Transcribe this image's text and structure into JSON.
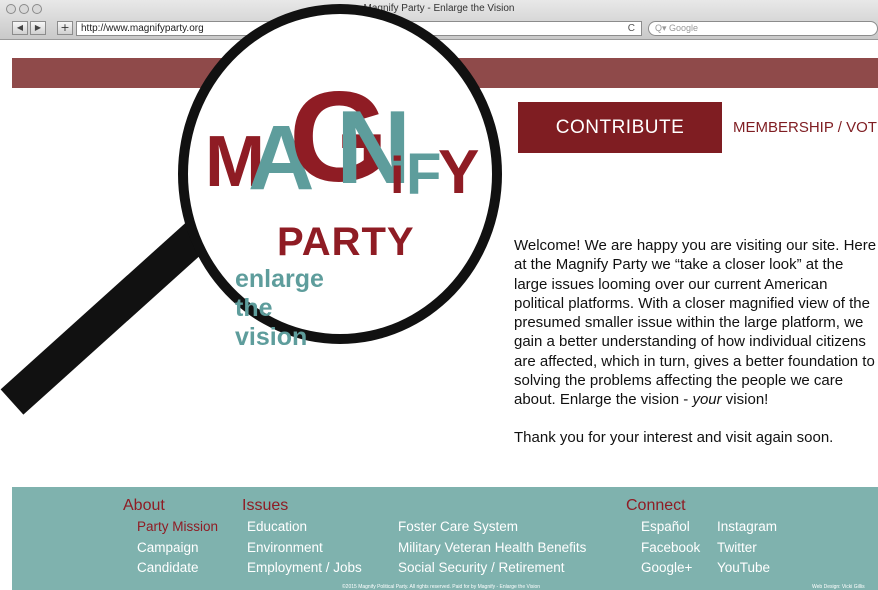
{
  "browser": {
    "window_title": "Magnify Party - Enlarge the Vision",
    "url": "http://www.magnifyparty.org",
    "search_placeholder": "Google",
    "back_glyph": "◀",
    "forward_glyph": "▶",
    "add_glyph": "+",
    "reload_glyph": "C"
  },
  "logo": {
    "letters": [
      "M",
      "A",
      "G",
      "N",
      "i",
      "F",
      "Y"
    ],
    "party": "PARTY",
    "tagline": "enlarge the vision"
  },
  "header": {
    "contribute_label": "CONTRIBUTE",
    "membership_label": "MEMBERSHIP / VOTE"
  },
  "welcome": {
    "paragraph_before_italic": "Welcome!  We are happy you are visiting our site.  Here at the Magnify Party we “take a closer look” at the large issues looming over our current American political platforms.  With a closer magnified view of the presumed smaller issue within the large platform, we gain a better understanding of how individual citizens are affected, which in turn, gives a better foundation to solving the problems affecting the people we care about.  Enlarge the vision - ",
    "italic_word": "your",
    "paragraph_after_italic": " vision!",
    "thanks": "Thank you for your interest and visit again soon."
  },
  "footer": {
    "about": {
      "heading": "About",
      "items": [
        "Party Mission",
        "Campaign",
        "Candidate"
      ]
    },
    "issues": {
      "heading": "Issues",
      "items": [
        "Education",
        "Environment",
        "Employment / Jobs",
        "Foster Care System",
        "Military Veteran Health Benefits",
        "Social Security / Retirement"
      ]
    },
    "connect": {
      "heading": "Connect",
      "items": [
        "Español",
        "Facebook",
        "Google+",
        "Instagram",
        "Twitter",
        "YouTube"
      ]
    },
    "copyright": "©2015 Magnify Political Party.  All rights reserved.  Paid for by Magnify - Enlarge the Vision",
    "credit": "Web Design: Vicki Gillis"
  },
  "colors": {
    "accent_red": "#7f1d22",
    "footer_teal": "#7fb2ae",
    "logo_teal": "#5e9d9c"
  }
}
